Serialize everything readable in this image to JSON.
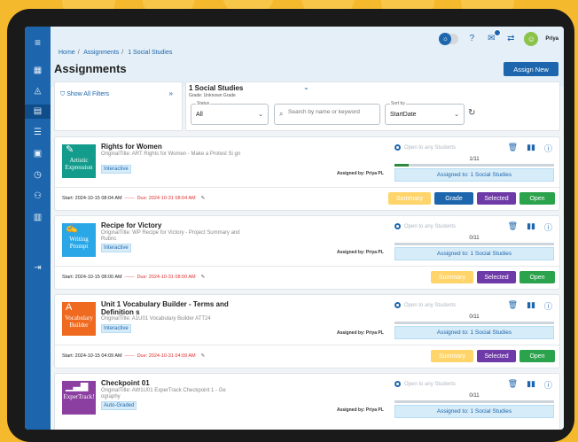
{
  "header": {
    "breadcrumbs": [
      "Home",
      "Assignments",
      "1 Social Studies"
    ],
    "page_title": "Assignments",
    "assign_button": "Assign New",
    "user_name": "Priya"
  },
  "filters": {
    "show_all": "Show All Filters",
    "class_name": "1 Social Studies",
    "grade": "Grade: Unknown Grade",
    "status_label": "Status",
    "status_value": "All",
    "search_placeholder": "Search by name or keyword",
    "sort_label": "Sort by",
    "sort_value": "StartDate"
  },
  "cards": [
    {
      "title": "Rights for Women",
      "original_title": "OriginalTitle: ART Rights for Women - Make a Protest Si gn",
      "tag": "Interactive",
      "thumb_text": "Artistic Expression",
      "thumb_color": "#139c8c",
      "assigned_by": "Assigned by: Priya PL",
      "open_any": "Open to any Students",
      "count": "1/11",
      "progress": 0.09,
      "assigned_to": "Assigned to: 1 Social Studies",
      "start": "Start: 2024-10-15 08:04 AM",
      "due": "Due: 2024-10-31 08:04 AM",
      "buttons": [
        "Summary",
        "Grade",
        "Selected",
        "Open"
      ]
    },
    {
      "title": "Recipe for Victory",
      "original_title": "OriginalTitle: WP Recipe for Victory - Project Summary and Rubric",
      "tag": "Interactive",
      "thumb_text": "Writing Prompt",
      "thumb_color": "#29a7e6",
      "assigned_by": "Assigned by: Priya PL",
      "open_any": "Open to any Students",
      "count": "0/11",
      "progress": 0,
      "assigned_to": "Assigned to: 1 Social Studies",
      "start": "Start: 2024-10-15 08:00 AM",
      "due": "Due: 2024-10-31 08:00 AM",
      "buttons": [
        "Summary",
        "Selected",
        "Open"
      ]
    },
    {
      "title": "Unit 1 Vocabulary Builder - Terms and Definition s",
      "original_title": "OriginalTitle: A1U01 Vocabulary Builder ATT24",
      "tag": "Interactive",
      "thumb_text": "Vocabulary Builder",
      "thumb_color": "#ef6a1f",
      "assigned_by": "Assigned by: Priya PL",
      "open_any": "Open to any Students",
      "count": "0/11",
      "progress": 0,
      "assigned_to": "Assigned to: 1 Social Studies",
      "start": "Start: 2024-10-15 04:09 AM",
      "due": "Due: 2024-10-31 04:09 AM",
      "buttons": [
        "Summary",
        "Selected",
        "Open"
      ]
    },
    {
      "title": "Checkpoint 01",
      "original_title": "OriginalTitle: AW1U01 ExperTrack Checkpoint 1 - Ge ography",
      "tag": "Auto-Graded",
      "thumb_text": "ExperTrack!",
      "thumb_color": "#8b3fa0",
      "assigned_by": "Assigned by: Priya PL",
      "open_any": "Open to any Students",
      "count": "0/11",
      "progress": 0,
      "assigned_to": "Assigned to: 1 Social Studies"
    }
  ]
}
